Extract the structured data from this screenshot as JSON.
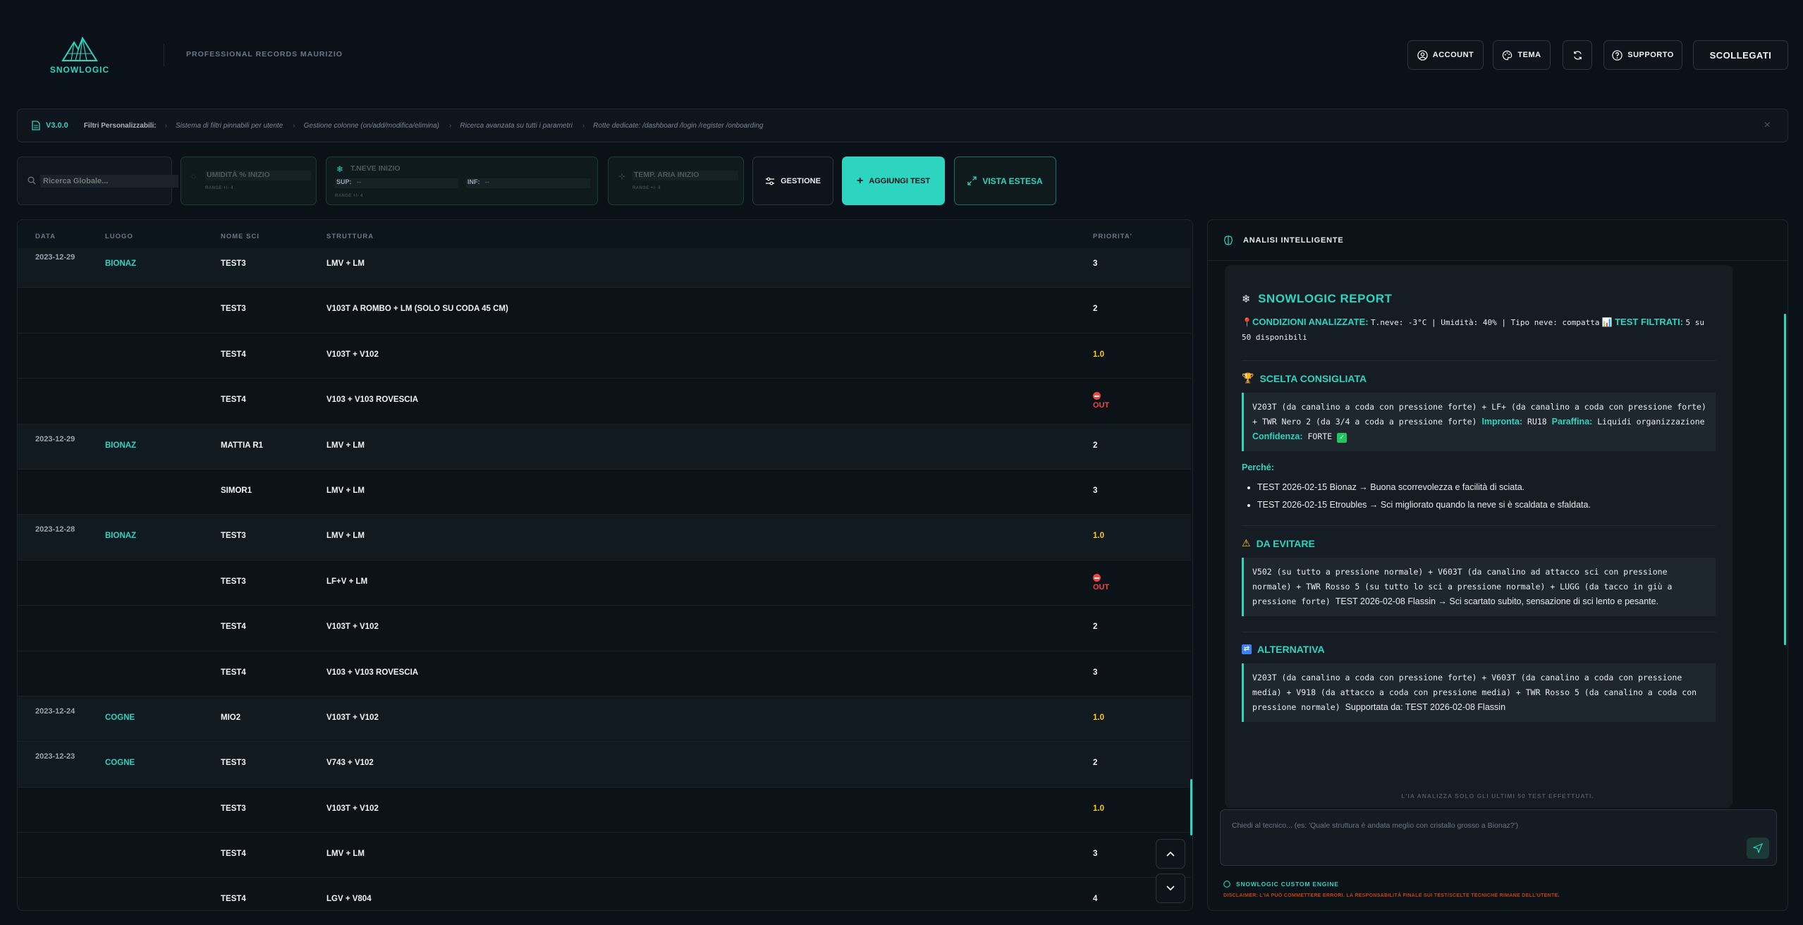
{
  "header": {
    "logo_text": "SNOWLOGIC",
    "title": "PROFESSIONAL RECORDS MAURIZIO",
    "buttons": {
      "account": "ACCOUNT",
      "tema": "TEMA",
      "supporto": "SUPPORTO",
      "logout": "SCOLLEGATI"
    }
  },
  "banner": {
    "version": "V3.0.0",
    "filters_label": "Filtri Personalizzabili:",
    "features": [
      "Sistema di filtri pinnabili per utente",
      "Gestione colonne (on/add/modifica/elimina)",
      "Ricerca avanzata su tutti i parametri",
      "Rotte dedicate: /dashboard /login /register /onboarding"
    ]
  },
  "filters": {
    "search_placeholder": "Ricerca Globale...",
    "umidita": {
      "label": "UMIDITÀ % INIZIO",
      "range": "RANGE +/- 4"
    },
    "tneve": {
      "label": "T.NEVE INIZIO",
      "sup": "SUP:",
      "inf": "INF:",
      "sup_value": "--",
      "inf_value": "--",
      "range": "RANGE +/- 4"
    },
    "temp_aria": {
      "label": "TEMP. ARIA INIZIO",
      "range": "RANGE +/- 4"
    },
    "gestione": "GESTIONE",
    "aggiungi": "AGGIUNGI TEST",
    "vista": "VISTA ESTESA"
  },
  "table": {
    "columns": [
      "DATA",
      "LUOGO",
      "NOME SCI",
      "STRUTTURA",
      "PRIORITA'"
    ],
    "rows": [
      {
        "date": "2023-12-29",
        "luogo": "BIONAZ",
        "nome": "TEST3",
        "struttura": "LMV + LM",
        "prio": "3",
        "ptype": "normal"
      },
      {
        "date": "",
        "luogo": "",
        "nome": "TEST3",
        "struttura": "V103T A ROMBO + LM (SOLO SU CODA 45 CM)",
        "prio": "2",
        "ptype": "normal"
      },
      {
        "date": "",
        "luogo": "",
        "nome": "TEST4",
        "struttura": "V103T + V102",
        "prio": "1.0",
        "ptype": "yellow"
      },
      {
        "date": "",
        "luogo": "",
        "nome": "TEST4",
        "struttura": "V103 + V103 ROVESCIA",
        "prio": "OUT",
        "ptype": "out"
      },
      {
        "date": "2023-12-29",
        "luogo": "BIONAZ",
        "nome": "MATTIA R1",
        "struttura": "LMV + LM",
        "prio": "2",
        "ptype": "normal"
      },
      {
        "date": "",
        "luogo": "",
        "nome": "SIMOR1",
        "struttura": "LMV + LM",
        "prio": "3",
        "ptype": "normal"
      },
      {
        "date": "2023-12-28",
        "luogo": "BIONAZ",
        "nome": "TEST3",
        "struttura": "LMV + LM",
        "prio": "1.0",
        "ptype": "yellow"
      },
      {
        "date": "",
        "luogo": "",
        "nome": "TEST3",
        "struttura": "LF+V + LM",
        "prio": "OUT",
        "ptype": "out"
      },
      {
        "date": "",
        "luogo": "",
        "nome": "TEST4",
        "struttura": "V103T + V102",
        "prio": "2",
        "ptype": "normal"
      },
      {
        "date": "",
        "luogo": "",
        "nome": "TEST4",
        "struttura": "V103 + V103 ROVESCIA",
        "prio": "3",
        "ptype": "normal"
      },
      {
        "date": "2023-12-24",
        "luogo": "COGNE",
        "nome": "MIO2",
        "struttura": "V103T + V102",
        "prio": "1.0",
        "ptype": "yellow"
      },
      {
        "date": "2023-12-23",
        "luogo": "COGNE",
        "nome": "TEST3",
        "struttura": "V743 + V102",
        "prio": "2",
        "ptype": "normal"
      },
      {
        "date": "",
        "luogo": "",
        "nome": "TEST3",
        "struttura": "V103T + V102",
        "prio": "1.0",
        "ptype": "yellow"
      },
      {
        "date": "",
        "luogo": "",
        "nome": "TEST4",
        "struttura": "LMV + LM",
        "prio": "3",
        "ptype": "normal"
      },
      {
        "date": "",
        "luogo": "",
        "nome": "TEST4",
        "struttura": "LGV + V804",
        "prio": "4",
        "ptype": "normal"
      }
    ]
  },
  "ai": {
    "title": "ANALISI INTELLIGENTE",
    "report_title": "SNOWLOGIC REPORT",
    "cond_label": "CONDIZIONI ANALIZZATE:",
    "cond_text": "T.neve: -3°C | Umidità: 40% | Tipo neve: compatta",
    "filtered_label": "TEST FILTRATI:",
    "filtered_text": "5 su 50 disponibili",
    "scelta_title": "SCELTA CONSIGLIATA",
    "scelta_text": "V203T (da canalino a coda con pressione forte) + LF+ (da canalino a coda con pressione forte) + TWR Nero 2 (da 3/4 a coda a pressione forte)",
    "impronta_label": "Impronta:",
    "impronta_value": "RU18",
    "paraffina_label": "Paraffina:",
    "paraffina_value": "Liquidi organizzazione",
    "confidenza_label": "Confidenza:",
    "confidenza_value": "FORTE",
    "perche_label": "Perché:",
    "perche_items": [
      "TEST 2026-02-15 Bionaz → Buona scorrevolezza e facilità di sciata.",
      "TEST 2026-02-15 Etroubles → Sci migliorato quando la neve si è scaldata e sfaldata."
    ],
    "evitare_title": "DA EVITARE",
    "evitare_text": "V502 (su tutto a pressione normale) + V603T (da canalino ad attacco sci con pressione normale) + TWR Rosso 5 (su tutto lo sci a pressione normale) + LUGG (da tacco in giù a pressione forte)",
    "evitare_note": "TEST 2026-02-08 Flassin → Sci scartato subito, sensazione di sci lento e pesante.",
    "alternativa_title": "ALTERNATIVA",
    "alternativa_text": "V203T (da canalino a coda con pressione forte) + V603T (da canalino a coda con pressione media) + V918 (da attacco a coda con pressione media) + TWR Rosso 5 (da canalino a coda con pressione normale)",
    "alternativa_note": "Supportata da: TEST 2026-02-08 Flassin",
    "note": "L'IA ANALIZZA SOLO GLI ULTIMI 50 TEST EFFETTUATI.",
    "chat_placeholder": "Chiedi al tecnico... (es: 'Quale struttura è andata meglio con cristallo grosso a Bionaz?')",
    "engine": "SNOWLOGIC CUSTOM ENGINE",
    "disclaimer": "DISCLAIMER: L'IA PUÒ COMMETTERE ERRORI. LA RESPONSABILITÀ FINALE SUI TEST/SCELTE TECNICHE RIMANE DELL'UTENTE."
  },
  "colors": {
    "accent": "#2dd4bf",
    "background": "#0b1118",
    "warning": "#facc15",
    "danger": "#ef4444"
  }
}
